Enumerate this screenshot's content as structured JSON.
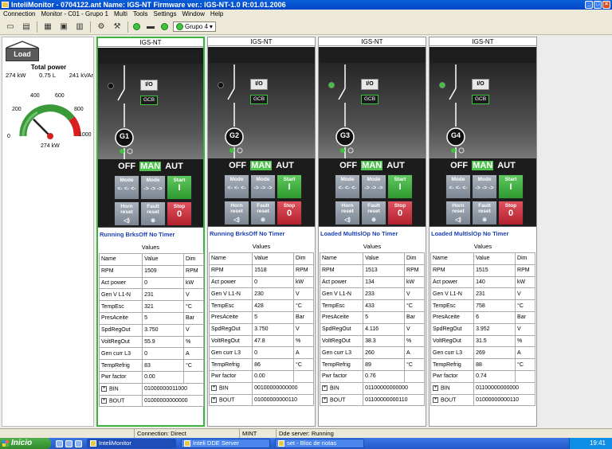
{
  "window": {
    "title": "InteliMonitor - 0704122.ant Name: IGS-NT Firmware ver.: IGS-NT-1.0 R:01.01.2006"
  },
  "menu": [
    "Connection",
    "Monitor - C01 - Grupo 1",
    "Multi",
    "Tools",
    "Settings",
    "Window",
    "Help"
  ],
  "toolbar": {
    "group_select": "Grupo 4"
  },
  "load": {
    "button_label": "Load",
    "total_title": "Total power",
    "kw": "274 kW",
    "pf": "0.75 L",
    "kvar": "241 kVAr",
    "gauge_ticks": [
      "0",
      "200",
      "400",
      "600",
      "800",
      "1000"
    ],
    "gauge_value_label": "274 kW",
    "gauge_fraction": 0.274
  },
  "panels": [
    {
      "title": "IGS-NT",
      "gen": "G1",
      "io": "I/O",
      "gcb": "GCB",
      "mains_indicator": "black",
      "modes": {
        "off": "OFF",
        "man": "MAN",
        "aut": "AUT"
      },
      "buttons": {
        "mode": "Mode",
        "mode_left": "<- <- <-",
        "mode_right": "-> -> ->",
        "start": "Start",
        "start_sym": "I",
        "horn": "Horn reset",
        "fault": "Fault reset",
        "stop": "Stop",
        "stop_sym": "0"
      },
      "status": "Running  BrksOff  No Timer",
      "values_title": "Values",
      "header": [
        "Name",
        "Value",
        "Dim"
      ],
      "rows": [
        [
          "RPM",
          "1509",
          "RPM"
        ],
        [
          "Act power",
          "0",
          "kW"
        ],
        [
          "Gen V L1-N",
          "231",
          "V"
        ],
        [
          "TempEsc",
          "321",
          "°C"
        ],
        [
          "PresAceite",
          "5",
          "Bar"
        ],
        [
          "SpdRegOut",
          "3.750",
          "V"
        ],
        [
          "VoltRegOut",
          "55.9",
          "%"
        ],
        [
          "Gen curr L3",
          "0",
          "A"
        ],
        [
          "TempRefrig",
          "83",
          "°C"
        ],
        [
          "Pwr factor",
          "0.00",
          ""
        ]
      ],
      "bin": [
        "BIN",
        "01000000011000"
      ],
      "bout": [
        "BOUT",
        "01000000000000"
      ]
    },
    {
      "title": "IGS-NT",
      "gen": "G2",
      "io": "I/O",
      "gcb": "GCB",
      "mains_indicator": "black",
      "modes": {
        "off": "OFF",
        "man": "MAN",
        "aut": "AUT"
      },
      "buttons": {
        "mode": "Mode",
        "mode_left": "<- <- <-",
        "mode_right": "-> -> ->",
        "start": "Start",
        "start_sym": "I",
        "horn": "Horn reset",
        "fault": "Fault reset",
        "stop": "Stop",
        "stop_sym": "0"
      },
      "status": "Running  BrksOff  No Timer",
      "values_title": "Values",
      "header": [
        "Name",
        "Value",
        "Dim"
      ],
      "rows": [
        [
          "RPM",
          "1518",
          "RPM"
        ],
        [
          "Act power",
          "0",
          "kW"
        ],
        [
          "Gen V L1-N",
          "230",
          "V"
        ],
        [
          "TempEsc",
          "428",
          "°C"
        ],
        [
          "PresAceite",
          "5",
          "Bar"
        ],
        [
          "SpdRegOut",
          "3.750",
          "V"
        ],
        [
          "VoltRegOut",
          "47.8",
          "%"
        ],
        [
          "Gen curr L3",
          "0",
          "A"
        ],
        [
          "TempRefrig",
          "86",
          "°C"
        ],
        [
          "Pwr factor",
          "0.00",
          ""
        ]
      ],
      "bin": [
        "BIN",
        "00100000000000"
      ],
      "bout": [
        "BOUT",
        "01000000000110"
      ]
    },
    {
      "title": "IGS-NT",
      "gen": "G3",
      "io": "I/O",
      "gcb": "GCB",
      "mains_indicator": "green",
      "modes": {
        "off": "OFF",
        "man": "MAN",
        "aut": "AUT"
      },
      "buttons": {
        "mode": "Mode",
        "mode_left": "<- <- <-",
        "mode_right": "-> -> ->",
        "start": "Start",
        "start_sym": "I",
        "horn": "Horn reset",
        "fault": "Fault reset",
        "stop": "Stop",
        "stop_sym": "0"
      },
      "status": "Loaded  MultIslOp  No Timer",
      "values_title": "Values",
      "header": [
        "Name",
        "Value",
        "Dim"
      ],
      "rows": [
        [
          "RPM",
          "1513",
          "RPM"
        ],
        [
          "Act power",
          "134",
          "kW"
        ],
        [
          "Gen V L1-N",
          "233",
          "V"
        ],
        [
          "TempEsc",
          "433",
          "°C"
        ],
        [
          "PresAceite",
          "5",
          "Bar"
        ],
        [
          "SpdRegOut",
          "4.116",
          "V"
        ],
        [
          "VoltRegOut",
          "38.3",
          "%"
        ],
        [
          "Gen curr L3",
          "260",
          "A"
        ],
        [
          "TempRefrig",
          "89",
          "°C"
        ],
        [
          "Pwr factor",
          "0.76",
          ""
        ]
      ],
      "bin": [
        "BIN",
        "01100000000000"
      ],
      "bout": [
        "BOUT",
        "01100000000110"
      ]
    },
    {
      "title": "IGS-NT",
      "gen": "G4",
      "io": "I/O",
      "gcb": "GCB",
      "mains_indicator": "green",
      "modes": {
        "off": "OFF",
        "man": "MAN",
        "aut": "AUT"
      },
      "buttons": {
        "mode": "Mode",
        "mode_left": "<- <- <-",
        "mode_right": "-> -> ->",
        "start": "Start",
        "start_sym": "I",
        "horn": "Horn reset",
        "fault": "Fault reset",
        "stop": "Stop",
        "stop_sym": "0"
      },
      "status": "Loaded  MultIslOp  No Timer",
      "values_title": "Values",
      "header": [
        "Name",
        "Value",
        "Dim"
      ],
      "rows": [
        [
          "RPM",
          "1515",
          "RPM"
        ],
        [
          "Act power",
          "140",
          "kW"
        ],
        [
          "Gen V L1-N",
          "231",
          "V"
        ],
        [
          "TempEsc",
          "758",
          "°C"
        ],
        [
          "PresAceite",
          "6",
          "Bar"
        ],
        [
          "SpdRegOut",
          "3.952",
          "V"
        ],
        [
          "VoltRegOut",
          "31.5",
          "%"
        ],
        [
          "Gen curr L3",
          "269",
          "A"
        ],
        [
          "TempRefrig",
          "88",
          "°C"
        ],
        [
          "Pwr factor",
          "0.74",
          ""
        ]
      ],
      "bin": [
        "BIN",
        "01100000000000"
      ],
      "bout": [
        "BOUT",
        "01000000000110"
      ]
    }
  ],
  "statusbar": {
    "connection": "Connection: Direct",
    "mode": "MINT",
    "dde": "Dde server: Running"
  },
  "taskbar": {
    "start": "Inicio",
    "tasks": [
      "InteliMonitor",
      "Inteli DDE Server",
      "set - Bloc de notas"
    ],
    "clock": "19:41"
  },
  "colors": {
    "accent_green": "#4fc24f",
    "status_blue": "#1a3fb4",
    "title_blue": "#0a5fd8"
  }
}
